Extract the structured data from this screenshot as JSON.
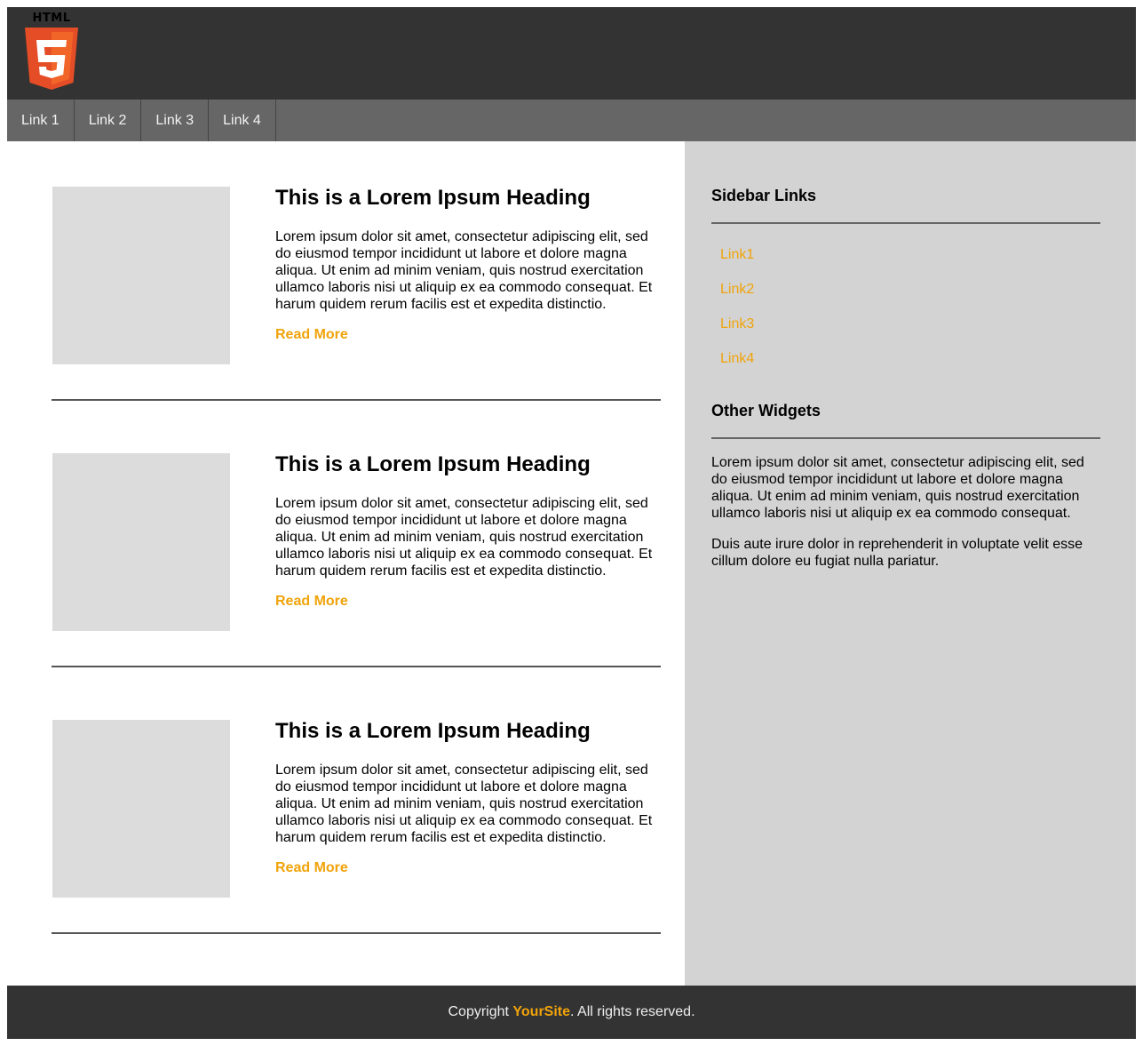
{
  "header": {
    "logo_text": "HTML",
    "logo_icon": "html5-logo-icon"
  },
  "nav": {
    "items": [
      {
        "label": "Link 1"
      },
      {
        "label": "Link 2"
      },
      {
        "label": "Link 3"
      },
      {
        "label": "Link 4"
      }
    ]
  },
  "articles": [
    {
      "heading": "This is a Lorem Ipsum Heading",
      "body": "Lorem ipsum dolor sit amet, consectetur adipiscing elit, sed do eiusmod tempor incididunt ut labore et dolore magna aliqua. Ut enim ad minim veniam, quis nostrud exercitation ullamco laboris nisi ut aliquip ex ea commodo consequat. Et harum quidem rerum facilis est et expedita distinctio.",
      "read_more": "Read More"
    },
    {
      "heading": "This is a Lorem Ipsum Heading",
      "body": "Lorem ipsum dolor sit amet, consectetur adipiscing elit, sed do eiusmod tempor incididunt ut labore et dolore magna aliqua. Ut enim ad minim veniam, quis nostrud exercitation ullamco laboris nisi ut aliquip ex ea commodo consequat. Et harum quidem rerum facilis est et expedita distinctio.",
      "read_more": "Read More"
    },
    {
      "heading": "This is a Lorem Ipsum Heading",
      "body": "Lorem ipsum dolor sit amet, consectetur adipiscing elit, sed do eiusmod tempor incididunt ut labore et dolore magna aliqua. Ut enim ad minim veniam, quis nostrud exercitation ullamco laboris nisi ut aliquip ex ea commodo consequat. Et harum quidem rerum facilis est et expedita distinctio.",
      "read_more": "Read More"
    }
  ],
  "sidebar": {
    "links_title": "Sidebar Links",
    "links": [
      {
        "label": "Link1"
      },
      {
        "label": "Link2"
      },
      {
        "label": "Link3"
      },
      {
        "label": "Link4"
      }
    ],
    "widgets_title": "Other Widgets",
    "widget_paragraph_1": "Lorem ipsum dolor sit amet, consectetur adipiscing elit, sed do eiusmod tempor incididunt ut labore et dolore magna aliqua. Ut enim ad minim veniam, quis nostrud exercitation ullamco laboris nisi ut aliquip ex ea commodo consequat.",
    "widget_paragraph_2": "Duis aute irure dolor in reprehenderit in voluptate velit esse cillum dolore eu fugiat nulla pariatur."
  },
  "footer": {
    "prefix": "Copyright ",
    "brand": "YourSite",
    "suffix": ". All rights reserved."
  },
  "colors": {
    "header_bg": "#333333",
    "nav_bg": "#666666",
    "sidebar_bg": "#d3d3d3",
    "accent": "#f0a30a",
    "thumb_bg": "#dcdcdc",
    "html5_orange": "#e44d26",
    "html5_orange_light": "#f16529"
  }
}
